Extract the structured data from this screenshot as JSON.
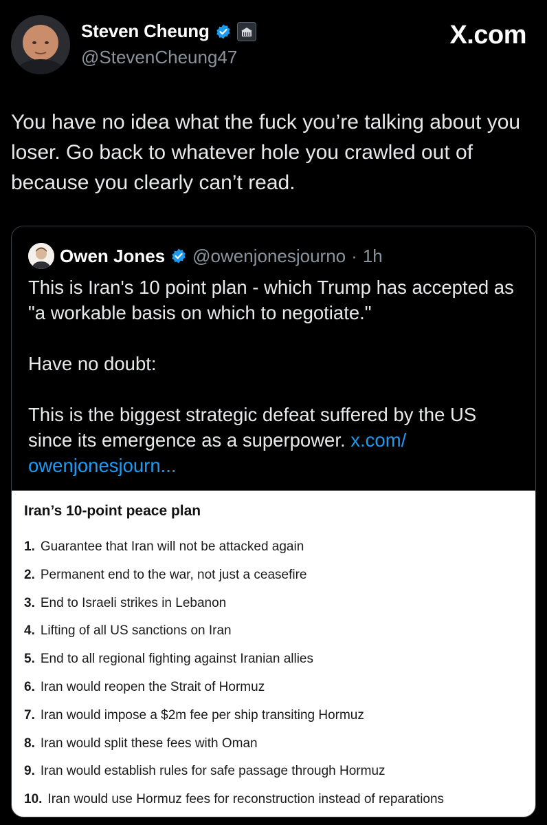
{
  "post": {
    "author": {
      "display_name": "Steven Cheung",
      "handle": "@StevenCheung47",
      "verified_icon": "verified-badge-icon",
      "affiliation_icon": "white-house-badge-icon"
    },
    "watermark": "X.com",
    "text": "You have no idea what the fuck you’re talking about you loser. Go back to whatever hole you crawled out of because you clearly can’t read."
  },
  "quote": {
    "author": {
      "display_name": "Owen Jones",
      "handle": "@owenjonesjourno",
      "separator": "·",
      "time": "1h"
    },
    "paragraphs": [
      "This is Iran's 10 point plan - which Trump has accepted as \"a workable basis on which to negotiate.\"",
      "Have no doubt:",
      "This is the biggest strategic defeat suffered by the US since its emergence as a superpower."
    ],
    "link_text": "x.com/\nowenjonesjourn...",
    "image": {
      "title": "Iran’s 10-point peace plan",
      "items": [
        {
          "num": "1.",
          "text": "Guarantee that Iran will not be attacked again"
        },
        {
          "num": "2.",
          "text": "Permanent end to the war, not just a ceasefire"
        },
        {
          "num": "3.",
          "text": "End to Israeli strikes in Lebanon"
        },
        {
          "num": "4.",
          "text": "Lifting of all US sanctions on Iran"
        },
        {
          "num": "5.",
          "text": "End to all regional fighting against Iranian allies"
        },
        {
          "num": "6.",
          "text": "Iran would reopen the Strait of Hormuz"
        },
        {
          "num": "7.",
          "text": "Iran would impose a $2m fee per ship transiting Hormuz"
        },
        {
          "num": "8.",
          "text": "Iran would split these fees with Oman"
        },
        {
          "num": "9.",
          "text": "Iran would establish rules for safe passage through Hormuz"
        },
        {
          "num": "10.",
          "text": "Iran would use Hormuz fees for reconstruction instead of reparations"
        }
      ]
    }
  },
  "colors": {
    "background": "#000000",
    "text": "#e7e9ea",
    "secondary": "#8b949c",
    "link": "#1d9bf0",
    "verified": "#1d9bf0"
  }
}
